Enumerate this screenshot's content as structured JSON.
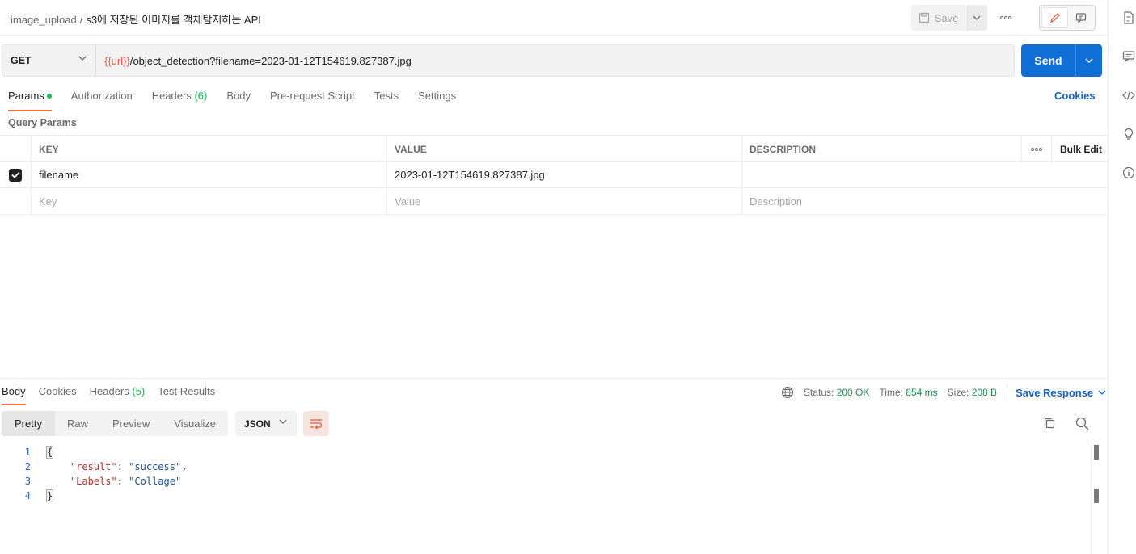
{
  "header": {
    "breadcrumb_parent": "image_upload",
    "breadcrumb_sep": "/",
    "breadcrumb_current": "s3에 저장된 이미지를 객체탐지하는 API",
    "save_label": "Save"
  },
  "request": {
    "method": "GET",
    "url_variable": "{{url}}",
    "url_path": "/object_detection?filename=2023-01-12T154619.827387.jpg",
    "send_label": "Send"
  },
  "tabs": [
    {
      "label": "Params"
    },
    {
      "label": "Authorization"
    },
    {
      "label": "Headers",
      "count": "(6)"
    },
    {
      "label": "Body"
    },
    {
      "label": "Pre-request Script"
    },
    {
      "label": "Tests"
    },
    {
      "label": "Settings"
    }
  ],
  "cookies_label": "Cookies",
  "query_params": {
    "title": "Query Params",
    "columns": {
      "key": "KEY",
      "value": "VALUE",
      "description": "DESCRIPTION",
      "bulk_edit": "Bulk Edit"
    },
    "rows": [
      {
        "checked": true,
        "key": "filename",
        "value": "2023-01-12T154619.827387.jpg",
        "description": ""
      }
    ],
    "placeholders": {
      "key": "Key",
      "value": "Value",
      "description": "Description"
    }
  },
  "response": {
    "tabs": [
      {
        "label": "Body"
      },
      {
        "label": "Cookies"
      },
      {
        "label": "Headers",
        "count": "(5)"
      },
      {
        "label": "Test Results"
      }
    ],
    "status_label": "Status:",
    "status_value": "200 OK",
    "time_label": "Time:",
    "time_value": "854 ms",
    "size_label": "Size:",
    "size_value": "208 B",
    "save_response_label": "Save Response",
    "views": [
      "Pretty",
      "Raw",
      "Preview",
      "Visualize"
    ],
    "format": "JSON",
    "line_numbers": [
      "1",
      "2",
      "3",
      "4"
    ],
    "body": {
      "open_brace": "{",
      "key1": "\"result\"",
      "val1": "\"success\"",
      "key2": "\"Labels\"",
      "val2": "\"Collage\"",
      "close_brace": "}"
    }
  },
  "colors": {
    "accent": "#ff6c37",
    "send": "#0f6fd6",
    "link": "#1a63c9",
    "success": "#1eb853"
  }
}
